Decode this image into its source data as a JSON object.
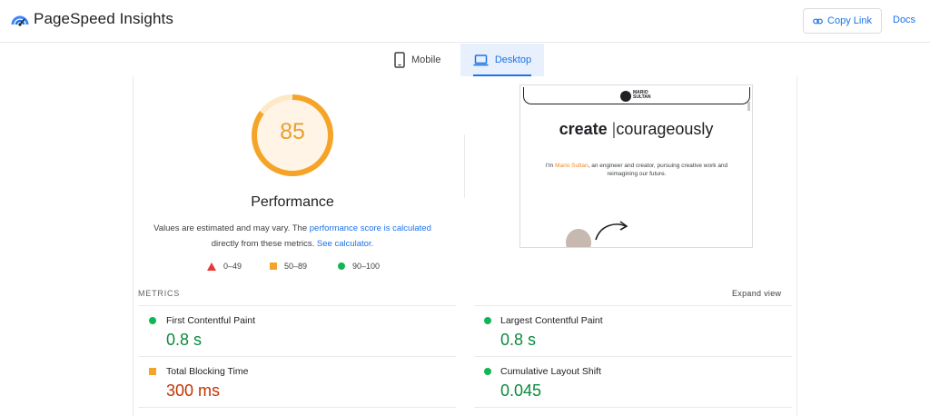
{
  "header": {
    "app_title": "PageSpeed Insights",
    "copy_link": "Copy Link",
    "docs": "Docs",
    "brand_colors": [
      "#1a73e8",
      "#4285f4",
      "#fbbc04",
      "#ea4335"
    ]
  },
  "tabs": [
    {
      "label": "Mobile",
      "icon": "phone-icon",
      "selected": false
    },
    {
      "label": "Desktop",
      "icon": "laptop-icon",
      "selected": true
    }
  ],
  "score": {
    "value": "85",
    "fraction": 0.85,
    "title": "Performance",
    "color": "#f4a529",
    "desc_1": "Values are estimated and may vary. The",
    "desc_link_1": "performance score is calculated",
    "desc_2": "directly from these metrics.",
    "desc_link_2": "See calculator."
  },
  "legend": [
    {
      "label": "0–49",
      "shape": "triangle",
      "color": "#e53935"
    },
    {
      "label": "50–89",
      "shape": "square",
      "color": "#f4a529"
    },
    {
      "label": "90–100",
      "shape": "circle",
      "color": "#12b553"
    }
  ],
  "preview": {
    "brand": [
      "MARIO",
      "SULTAN"
    ],
    "hero_bold": "create",
    "hero_sep": "|",
    "hero_rest": "courageously",
    "intro_1": "I'm",
    "intro_name": "Mario Sultan",
    "intro_2": ", an engineer and creator, pursuing creative work and reimagining our future."
  },
  "metrics": {
    "label": "METRICS",
    "expand": "Expand view",
    "items": [
      {
        "name": "First Contentful Paint",
        "value": "0.8 s",
        "status": "good"
      },
      {
        "name": "Largest Contentful Paint",
        "value": "0.8 s",
        "status": "good"
      },
      {
        "name": "Total Blocking Time",
        "value": "300 ms",
        "status": "average"
      },
      {
        "name": "Cumulative Layout Shift",
        "value": "0.045",
        "status": "good"
      }
    ]
  }
}
